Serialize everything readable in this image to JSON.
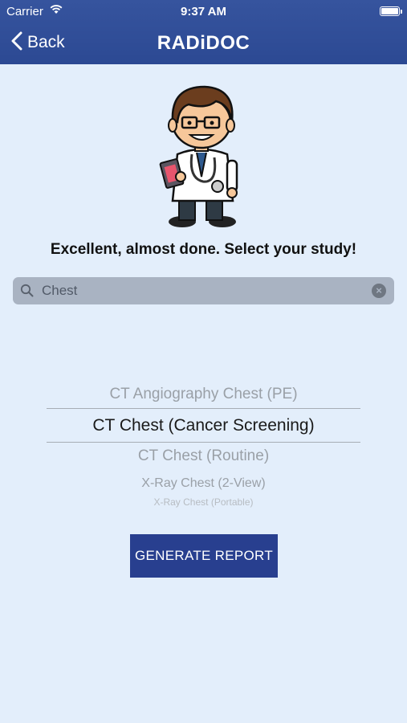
{
  "status_bar": {
    "carrier": "Carrier",
    "time": "9:37 AM"
  },
  "nav": {
    "back_label": "Back",
    "brand": "RADiDOC"
  },
  "prompt": "Excellent, almost done. Select your study!",
  "search": {
    "value": "Chest"
  },
  "picker": {
    "options": [
      "CT Angiography Chest (PE)",
      "CT Chest (Cancer Screening)",
      "CT Chest (Routine)",
      "X-Ray Chest (2-View)",
      "X-Ray Chest (Portable)"
    ],
    "selected": "CT Chest (Cancer Screening)"
  },
  "generate_label": "GENERATE REPORT",
  "colors": {
    "header": "#2c4993",
    "background": "#e3eefb",
    "button": "#283f8f"
  }
}
